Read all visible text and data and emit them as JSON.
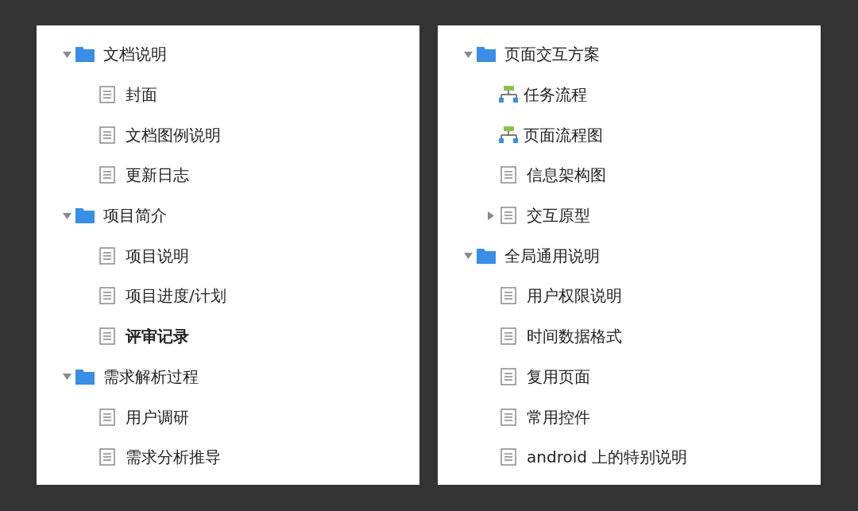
{
  "panels": [
    {
      "tree": [
        {
          "kind": "folder",
          "label": "文档说明",
          "expanded": true,
          "selected": false,
          "children": [
            {
              "kind": "page",
              "label": "封面",
              "selected": false
            },
            {
              "kind": "page",
              "label": "文档图例说明",
              "selected": false
            },
            {
              "kind": "page",
              "label": "更新日志",
              "selected": false
            }
          ]
        },
        {
          "kind": "folder",
          "label": "项目简介",
          "expanded": true,
          "selected": false,
          "children": [
            {
              "kind": "page",
              "label": "项目说明",
              "selected": false
            },
            {
              "kind": "page",
              "label": "项目进度/计划",
              "selected": false
            },
            {
              "kind": "page",
              "label": "评审记录",
              "selected": true
            }
          ]
        },
        {
          "kind": "folder",
          "label": "需求解析过程",
          "expanded": true,
          "selected": false,
          "children": [
            {
              "kind": "page",
              "label": "用户调研",
              "selected": false
            },
            {
              "kind": "page",
              "label": "需求分析推导",
              "selected": false
            }
          ]
        }
      ]
    },
    {
      "tree": [
        {
          "kind": "folder",
          "label": "页面交互方案",
          "expanded": true,
          "selected": false,
          "children": [
            {
              "kind": "flow",
              "label": "任务流程",
              "selected": false
            },
            {
              "kind": "flow",
              "label": "页面流程图",
              "selected": false
            },
            {
              "kind": "page",
              "label": "信息架构图",
              "selected": false
            },
            {
              "kind": "page",
              "label": "交互原型",
              "expanded": false,
              "selected": false
            }
          ]
        },
        {
          "kind": "folder",
          "label": "全局通用说明",
          "expanded": true,
          "selected": false,
          "children": [
            {
              "kind": "page",
              "label": "用户权限说明",
              "selected": false
            },
            {
              "kind": "page",
              "label": "时间数据格式",
              "selected": false
            },
            {
              "kind": "page",
              "label": "复用页面",
              "selected": false
            },
            {
              "kind": "page",
              "label": "常用控件",
              "selected": false
            },
            {
              "kind": "page",
              "label": "android 上的特别说明",
              "selected": false
            }
          ]
        }
      ]
    }
  ]
}
